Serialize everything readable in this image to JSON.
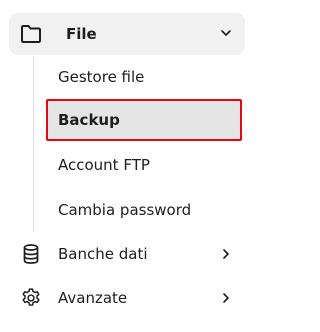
{
  "sidebar": {
    "file_section": {
      "label": "File",
      "icon": "folder-icon",
      "expanded": true,
      "items": [
        {
          "label": "Gestore file",
          "active": false
        },
        {
          "label": "Backup",
          "active": true
        },
        {
          "label": "Account FTP",
          "active": false
        },
        {
          "label": "Cambia password",
          "active": false
        }
      ]
    },
    "nav": [
      {
        "label": "Banche dati",
        "icon": "database-icon"
      },
      {
        "label": "Avanzate",
        "icon": "gear-icon"
      }
    ]
  },
  "colors": {
    "text": "#1d1e20",
    "header_bg": "#f1f1f1",
    "active_bg": "#e5e5e5",
    "highlight_border": "#e30613",
    "line": "#dcdcdc"
  }
}
